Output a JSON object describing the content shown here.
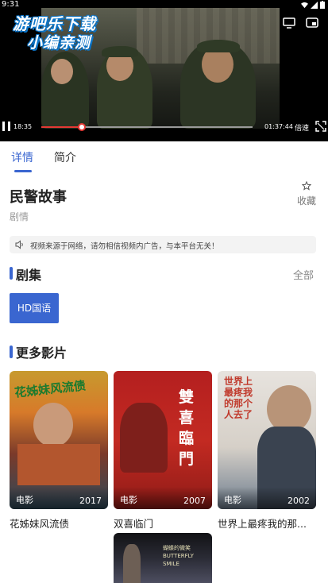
{
  "status": {
    "time": "9:31"
  },
  "player": {
    "watermark_line1": "游吧乐下载",
    "watermark_line2": "小编亲测",
    "current_time": "18:35",
    "total_time": "01:37:44",
    "speed_label": "倍速",
    "progress": 0.19
  },
  "tabs": [
    {
      "label": "详情",
      "active": true
    },
    {
      "label": "简介",
      "active": false
    }
  ],
  "movie": {
    "title": "民警故事",
    "genre": "剧情",
    "favorite_label": "收藏"
  },
  "notice": {
    "text": "视频来源于网络，请勿相信视频内广告，与本平台无关！"
  },
  "episodes": {
    "title": "剧集",
    "all_label": "全部",
    "items": [
      {
        "label": "HD国语"
      }
    ]
  },
  "more": {
    "title": "更多影片",
    "items": [
      {
        "name": "花姊妹风流债",
        "category": "电影",
        "year": "2017",
        "poster_text": "花姊妹风流债"
      },
      {
        "name": "双喜临门",
        "category": "电影",
        "year": "2007",
        "poster_text": "雙喜臨門"
      },
      {
        "name": "世界上最疼我的那...",
        "category": "电影",
        "year": "2002",
        "poster_text": "世界上最疼我的那个人去了"
      },
      {
        "name": "",
        "category": "",
        "year": "",
        "poster_text": "蝴蝶的微笑 BUTTERFLY SMILE"
      }
    ]
  },
  "colors": {
    "accent": "#3a66d0",
    "progress": "#e53935"
  }
}
